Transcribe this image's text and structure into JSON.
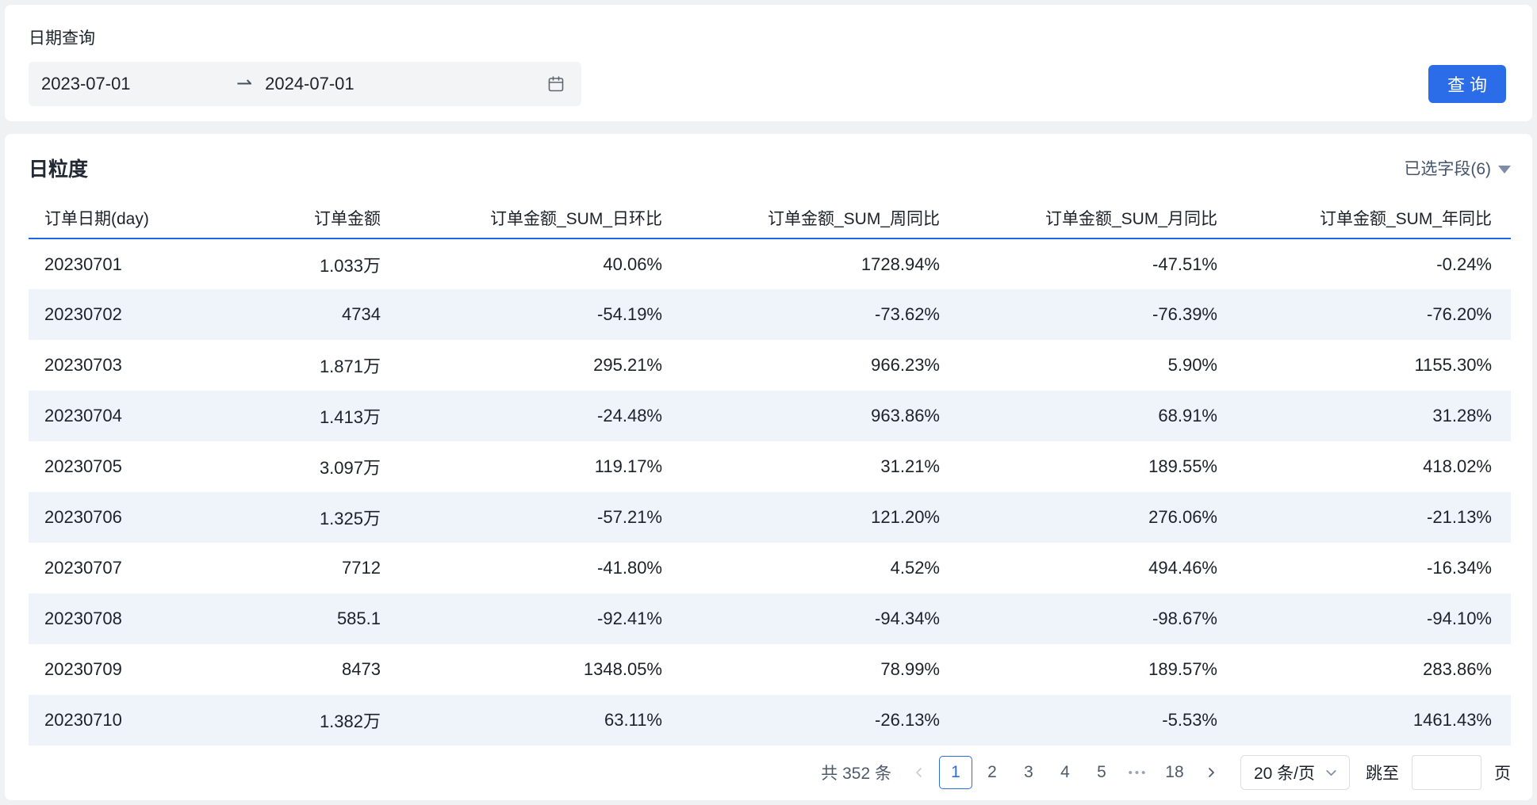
{
  "query_section": {
    "label": "日期查询",
    "date_start": "2023-07-01",
    "date_end": "2024-07-01",
    "search_button": "查 询"
  },
  "icons": {
    "range_separator": "⇀"
  },
  "table_section": {
    "title": "日粒度",
    "selected_fields": "已选字段(6)",
    "columns": [
      "订单日期(day)",
      "订单金额",
      "订单金额_SUM_日环比",
      "订单金额_SUM_周同比",
      "订单金额_SUM_月同比",
      "订单金额_SUM_年同比"
    ],
    "rows": [
      [
        "20230701",
        "1.033万",
        "40.06%",
        "1728.94%",
        "-47.51%",
        "-0.24%"
      ],
      [
        "20230702",
        "4734",
        "-54.19%",
        "-73.62%",
        "-76.39%",
        "-76.20%"
      ],
      [
        "20230703",
        "1.871万",
        "295.21%",
        "966.23%",
        "5.90%",
        "1155.30%"
      ],
      [
        "20230704",
        "1.413万",
        "-24.48%",
        "963.86%",
        "68.91%",
        "31.28%"
      ],
      [
        "20230705",
        "3.097万",
        "119.17%",
        "31.21%",
        "189.55%",
        "418.02%"
      ],
      [
        "20230706",
        "1.325万",
        "-57.21%",
        "121.20%",
        "276.06%",
        "-21.13%"
      ],
      [
        "20230707",
        "7712",
        "-41.80%",
        "4.52%",
        "494.46%",
        "-16.34%"
      ],
      [
        "20230708",
        "585.1",
        "-92.41%",
        "-94.34%",
        "-98.67%",
        "-94.10%"
      ],
      [
        "20230709",
        "8473",
        "1348.05%",
        "78.99%",
        "189.57%",
        "283.86%"
      ],
      [
        "20230710",
        "1.382万",
        "63.11%",
        "-26.13%",
        "-5.53%",
        "1461.43%"
      ]
    ]
  },
  "pagination": {
    "total": "共 352 条",
    "pages": [
      "1",
      "2",
      "3",
      "4",
      "5"
    ],
    "active_page": "1",
    "ellipsis": "•••",
    "last_page": "18",
    "page_size": "20 条/页",
    "jump_label": "跳至",
    "jump_value": "",
    "jump_suffix": "页"
  },
  "colors": {
    "accent_blue": "#2b6ce8",
    "header_line_blue": "#2363e6",
    "row_stripe": "#eff3fa",
    "text_primary": "#1d2129",
    "text_secondary": "#4e5969",
    "disabled_gray": "#c9cdd4",
    "control_border": "#dcdee2",
    "page_background": "#f0f1f3"
  }
}
